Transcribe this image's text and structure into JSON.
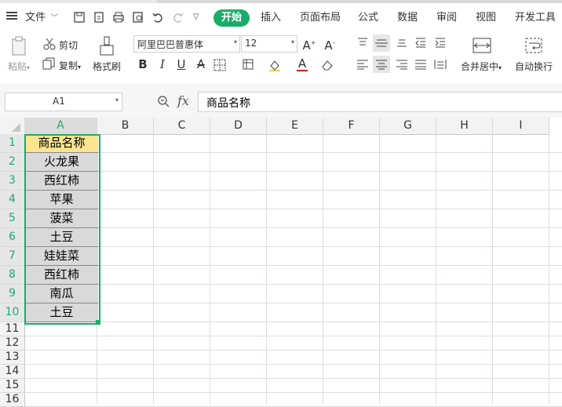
{
  "menu": {
    "file_label": "文件",
    "tabs": [
      "开始",
      "插入",
      "页面布局",
      "公式",
      "数据",
      "审阅",
      "视图",
      "开发工具"
    ],
    "active_tab": "开始"
  },
  "ribbon": {
    "paste": "粘贴",
    "cut": "剪切",
    "copy": "复制",
    "format_painter": "格式刷",
    "font_name": "阿里巴巴普惠体",
    "font_size": "12",
    "merge_center": "合并居中",
    "wrap_text": "自动换行"
  },
  "formula_bar": {
    "cell_ref": "A1",
    "fx_label": "fx",
    "content": "商品名称"
  },
  "sheet": {
    "columns": [
      "A",
      "B",
      "C",
      "D",
      "E",
      "F",
      "G",
      "H",
      "I"
    ],
    "rows": [
      "1",
      "2",
      "3",
      "4",
      "5",
      "6",
      "7",
      "8",
      "9",
      "10",
      "11",
      "12",
      "13",
      "14",
      "15",
      "16"
    ],
    "column_a": [
      "商品名称",
      "火龙果",
      "西红柿",
      "苹果",
      "菠菜",
      "土豆",
      "娃娃菜",
      "西红柿",
      "南瓜",
      "土豆"
    ]
  },
  "colors": {
    "accent": "#1aad6a",
    "header_fill": "#fde58f",
    "cell_fill": "#d9d9d9"
  }
}
